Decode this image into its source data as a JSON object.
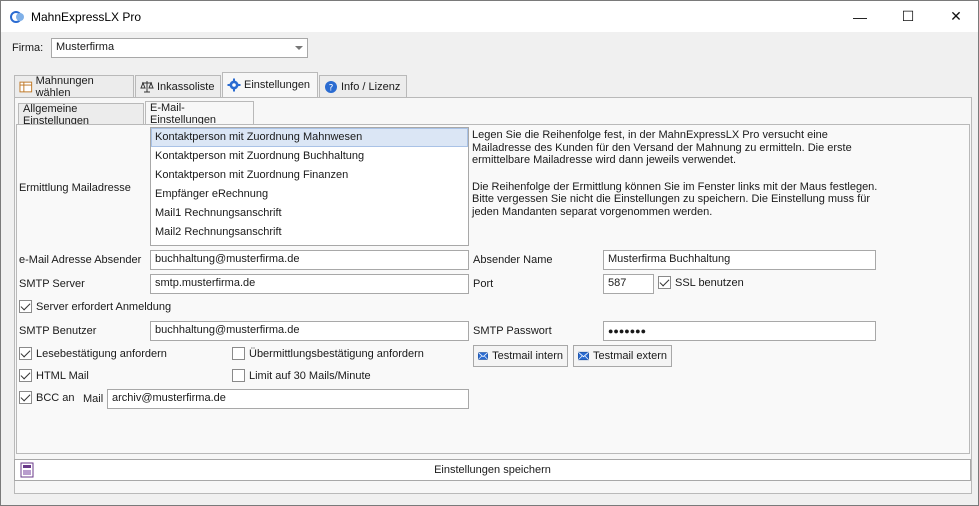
{
  "window": {
    "title": "MahnExpressLX Pro",
    "minimize_label": "—",
    "maximize_label": "☐",
    "close_label": "✕"
  },
  "firma": {
    "label": "Firma:",
    "value": "Musterfirma"
  },
  "main_tabs": [
    {
      "label": "Mahnungen wählen",
      "icon": "table-icon"
    },
    {
      "label": "Inkassoliste",
      "icon": "scales-icon"
    },
    {
      "label": "Einstellungen",
      "icon": "gear-icon"
    },
    {
      "label": "Info / Lizenz",
      "icon": "help-icon"
    }
  ],
  "sub_tabs": [
    {
      "label": "Allgemeine Einstellungen"
    },
    {
      "label": "E-Mail-Einstellungen"
    }
  ],
  "ermittlung": {
    "label": "Ermittlung Mailadresse",
    "items": [
      "Kontaktperson mit Zuordnung Mahnwesen",
      "Kontaktperson mit Zuordnung Buchhaltung",
      "Kontaktperson mit Zuordnung Finanzen",
      "Empfänger eRechnung",
      "Mail1 Rechnungsanschrift",
      "Mail2 Rechnungsanschrift"
    ],
    "info_p1": "Legen Sie die Reihenfolge fest, in der MahnExpressLX Pro versucht eine Mailadresse des Kunden für den Versand der Mahnung zu ermitteln. Die erste ermittelbare Mailadresse wird dann jeweils verwendet.",
    "info_p2": "Die Reihenfolge der Ermittlung können Sie im Fenster links mit der Maus festlegen. Bitte vergessen Sie nicht die Einstellungen zu speichern. Die Einstellung muss für jeden Mandanten separat vorgenommen werden."
  },
  "form": {
    "absender_label": "e-Mail Adresse Absender",
    "absender_value": "buchhaltung@musterfirma.de",
    "absender_name_label": "Absender Name",
    "absender_name_value": "Musterfirma Buchhaltung",
    "smtp_server_label": "SMTP Server",
    "smtp_server_value": "smtp.musterfirma.de",
    "port_label": "Port",
    "port_value": "587",
    "ssl_label": "SSL benutzen",
    "anmeldung_label": "Server erfordert Anmeldung",
    "smtp_user_label": "SMTP Benutzer",
    "smtp_user_value": "buchhaltung@musterfirma.de",
    "smtp_pass_label": "SMTP Passwort",
    "smtp_pass_value": "●●●●●●●",
    "lesebest_label": "Lesebestätigung anfordern",
    "uebermittlung_label": "Übermittlungsbestätigung anfordern",
    "html_label": "HTML Mail",
    "limit_label": "Limit auf 30 Mails/Minute",
    "bcc_label": "BCC an",
    "mail_label": "Mail",
    "bcc_value": "archiv@musterfirma.de",
    "testmail_intern_label": "Testmail intern",
    "testmail_extern_label": "Testmail extern"
  },
  "checkbox_states": {
    "ssl": true,
    "anmeldung": true,
    "lesebest": true,
    "uebermittlung": false,
    "html": true,
    "limit": false,
    "bcc": true
  },
  "save_label": "Einstellungen speichern",
  "colors": {
    "selection": "#dbe6f5",
    "accent_blue": "#2a6bd1"
  }
}
